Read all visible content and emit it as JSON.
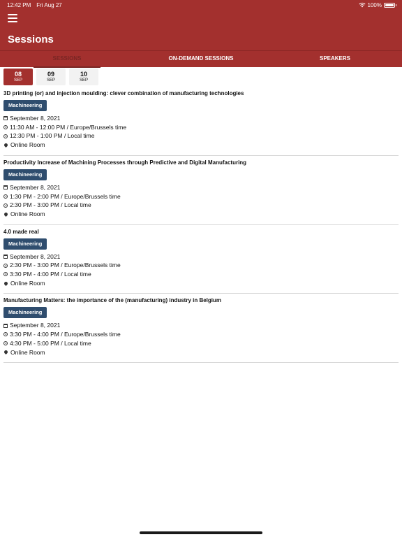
{
  "status": {
    "time": "12:42 PM",
    "date": "Fri Aug 27",
    "battery": "100%"
  },
  "header": {
    "title": "Sessions"
  },
  "tabs": [
    {
      "label": "SESSIONS",
      "active": true
    },
    {
      "label": "ON-DEMAND SESSIONS",
      "active": false
    },
    {
      "label": "SPEAKERS",
      "active": false
    }
  ],
  "dates": [
    {
      "day": "08",
      "month": "SEP",
      "active": true
    },
    {
      "day": "09",
      "month": "SEP",
      "active": false
    },
    {
      "day": "10",
      "month": "SEP",
      "active": false
    }
  ],
  "sessions": [
    {
      "title": "3D printing (or) and injection moulding: clever combination of manufacturing technologies",
      "tag": "Machineering",
      "date": "September 8, 2021",
      "time_brussels": "11:30 AM - 12:00 PM / Europe/Brussels time",
      "time_local": "12:30 PM - 1:00 PM / Local time",
      "location": "Online Room"
    },
    {
      "title": "Productivity Increase of Machining Processes through Predictive and Digital Manufacturing",
      "tag": "Machineering",
      "date": "September 8, 2021",
      "time_brussels": "1:30 PM - 2:00 PM / Europe/Brussels time",
      "time_local": "2:30 PM - 3:00 PM / Local time",
      "location": "Online Room"
    },
    {
      "title": "4.0 made real",
      "tag": "Machineering",
      "date": "September 8, 2021",
      "time_brussels": "2:30 PM - 3:00 PM / Europe/Brussels time",
      "time_local": "3:30 PM - 4:00 PM / Local time",
      "location": "Online Room"
    },
    {
      "title": "Manufacturing Matters: the importance of the (manufacturing) industry in Belgium",
      "tag": "Machineering",
      "date": "September 8, 2021",
      "time_brussels": "3:30 PM - 4:00 PM / Europe/Brussels time",
      "time_local": "4:30 PM - 5:00 PM / Local time",
      "location": "Online Room"
    }
  ],
  "colors": {
    "brand": "#a3302e",
    "tag": "#2f4d6e"
  }
}
